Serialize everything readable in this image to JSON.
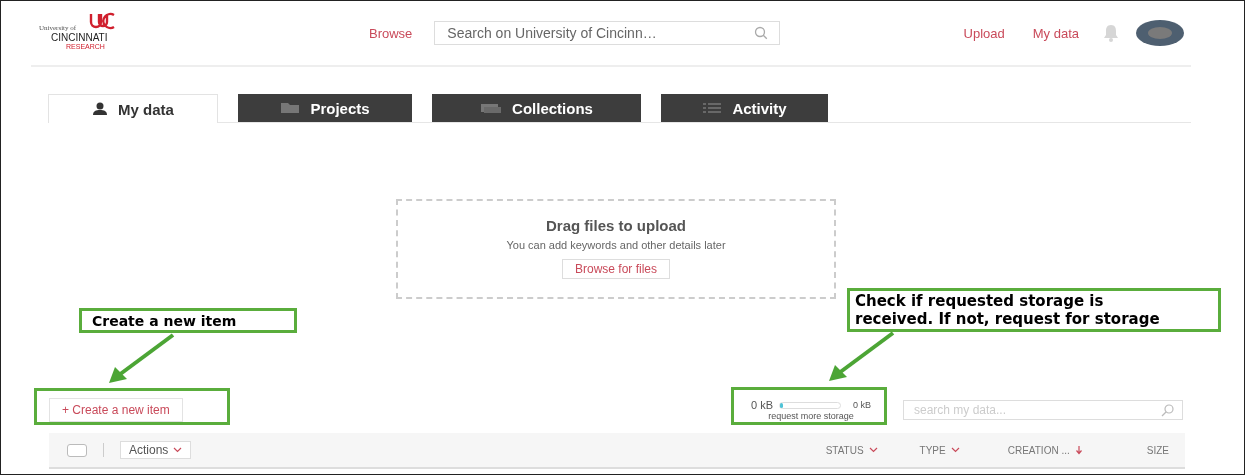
{
  "header": {
    "logo": {
      "line_1": "University of",
      "line_2": "CINCINNATI",
      "line_3": "RESEARCH"
    },
    "browse_link": "Browse",
    "search": {
      "placeholder": "Search on University of Cincinn…"
    },
    "links": [
      "Upload",
      "My data"
    ]
  },
  "tabs": [
    {
      "label": "My data",
      "selected": true
    },
    {
      "label": "Projects",
      "selected": false
    },
    {
      "label": "Collections",
      "selected": false
    },
    {
      "label": "Activity",
      "selected": false
    }
  ],
  "dropzone": {
    "title": "Drag files to upload",
    "subtitle": "You can add keywords and other details later",
    "button": "Browse for files"
  },
  "toolbar": {
    "create_button": "+ Create a new item",
    "storage": {
      "used": "0 kB",
      "level": 0.05,
      "total": "0 kB",
      "link": "request more storage"
    },
    "search": {
      "placeholder": "search my data..."
    }
  },
  "table": {
    "select_all": {
      "checked": false
    },
    "actions": "Actions",
    "columns": [
      {
        "label": "STATUS",
        "kind": "dropdown"
      },
      {
        "label": "TYPE",
        "kind": "dropdown"
      },
      {
        "label": "CREATION ...",
        "kind": "sorted"
      },
      {
        "label": "SIZE",
        "kind": "plain"
      }
    ]
  },
  "annotations": [
    {
      "text": "Create a new item"
    },
    {
      "text": "Check if requested storage is received. If not, request for storage"
    }
  ]
}
